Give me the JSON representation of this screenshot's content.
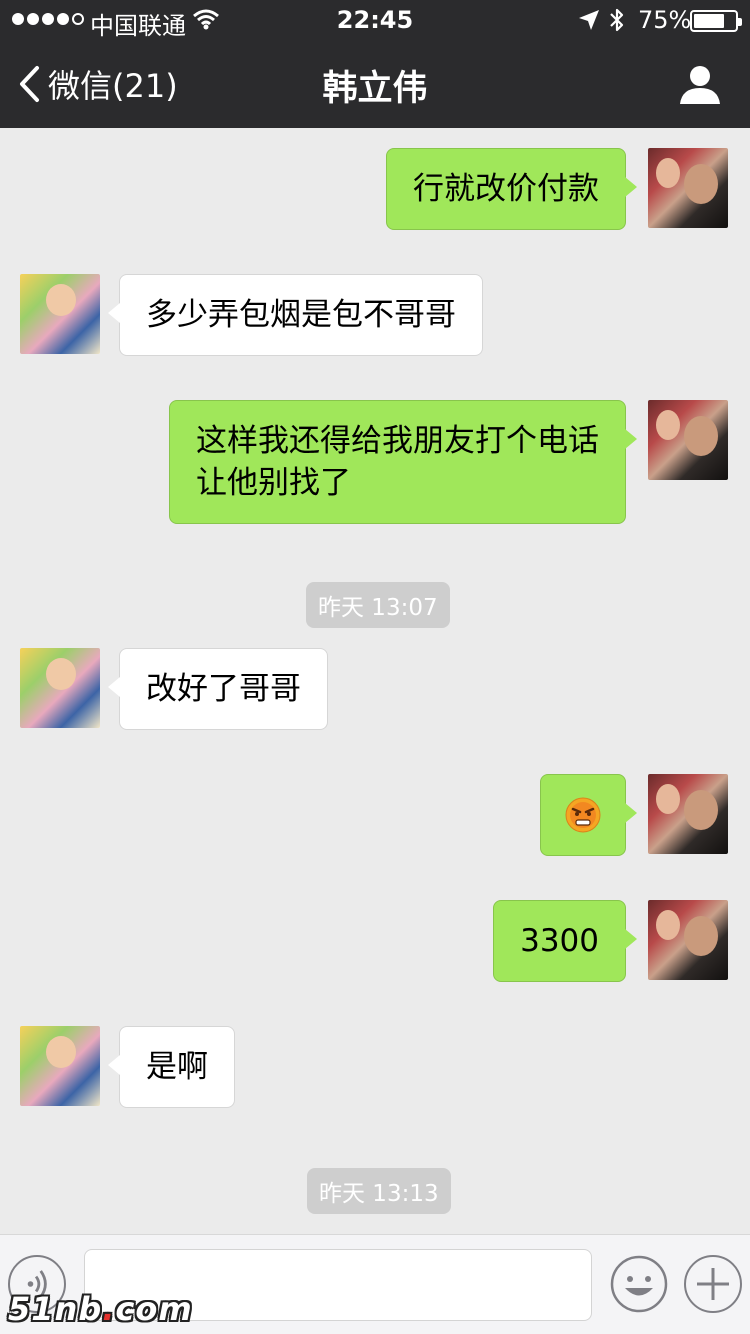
{
  "status_bar": {
    "carrier": "中国联通",
    "time": "22:45",
    "battery_percent": "75%",
    "battery_level": 0.75
  },
  "nav": {
    "back_label": "微信(21)",
    "title": "韩立伟"
  },
  "messages": [
    {
      "type": "text",
      "sender": "me",
      "text": "行就改价付款"
    },
    {
      "type": "text",
      "sender": "other",
      "text": "多少弄包烟是包不哥哥"
    },
    {
      "type": "text",
      "sender": "me",
      "lines": [
        "这样我还得给我朋友打个电话",
        "让他别找了"
      ]
    },
    {
      "type": "timestamp",
      "text": "昨天 13:07"
    },
    {
      "type": "text",
      "sender": "other",
      "text": "改好了哥哥"
    },
    {
      "type": "emoji",
      "sender": "me",
      "emoji": "angry-face-icon"
    },
    {
      "type": "text",
      "sender": "me",
      "text": "3300"
    },
    {
      "type": "text",
      "sender": "other",
      "text": "是啊"
    },
    {
      "type": "timestamp",
      "text": "昨天 13:13"
    }
  ],
  "input": {
    "placeholder": ""
  },
  "watermark": {
    "part1": "51nb",
    "dot": ".",
    "part2": "com"
  },
  "colors": {
    "nav_bg": "#2b2b2d",
    "chat_bg": "#ebebeb",
    "my_bubble": "#a0e75a",
    "other_bubble": "#ffffff"
  }
}
